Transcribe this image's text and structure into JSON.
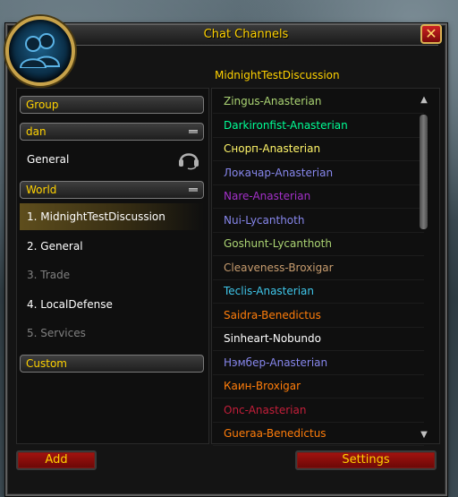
{
  "window": {
    "title": "Chat Channels",
    "close_label": "✕"
  },
  "channel_heading": "MidnightTestDiscussion",
  "left": {
    "headers": {
      "group": "Group",
      "dan": "dan",
      "world": "World",
      "custom": "Custom"
    },
    "dan_channels": [
      {
        "label": "General"
      }
    ],
    "world_channels": [
      {
        "label": "1. MidnightTestDiscussion",
        "state": "selected"
      },
      {
        "label": "2. General",
        "state": "normal"
      },
      {
        "label": "3. Trade",
        "state": "disabled"
      },
      {
        "label": "4. LocalDefense",
        "state": "normal"
      },
      {
        "label": "5. Services",
        "state": "disabled"
      }
    ]
  },
  "members": [
    {
      "name": "Zingus-Anasterian",
      "color": "#abd473"
    },
    {
      "name": "Darkironfist-Anasterian",
      "color": "#00ff96"
    },
    {
      "name": "Снорп-Anasterian",
      "color": "#fff569"
    },
    {
      "name": "Локачар-Anasterian",
      "color": "#8787ed"
    },
    {
      "name": "Nare-Anasterian",
      "color": "#a330c9"
    },
    {
      "name": "Nui-Lycanthoth",
      "color": "#8787ed"
    },
    {
      "name": "Goshunt-Lycanthoth",
      "color": "#abd473"
    },
    {
      "name": "Cleaveness-Broxigar",
      "color": "#c79c6e"
    },
    {
      "name": "Teclis-Anasterian",
      "color": "#3fc7eb"
    },
    {
      "name": "Saidra-Benedictus",
      "color": "#ff7d0a"
    },
    {
      "name": "Sinheart-Nobundo",
      "color": "#ffffff"
    },
    {
      "name": "Нэмбер-Anasterian",
      "color": "#8787ed"
    },
    {
      "name": "Каин-Broxigar",
      "color": "#ff7d0a"
    },
    {
      "name": "Onc-Anasterian",
      "color": "#c41e3a"
    },
    {
      "name": "Gueraa-Benedictus",
      "color": "#ff7d0a"
    }
  ],
  "buttons": {
    "add": "Add",
    "settings": "Settings"
  },
  "colors": {
    "accent_gold": "#ffd200",
    "button_red": "#a4130f",
    "panel_bg": "#0f0f0f"
  }
}
